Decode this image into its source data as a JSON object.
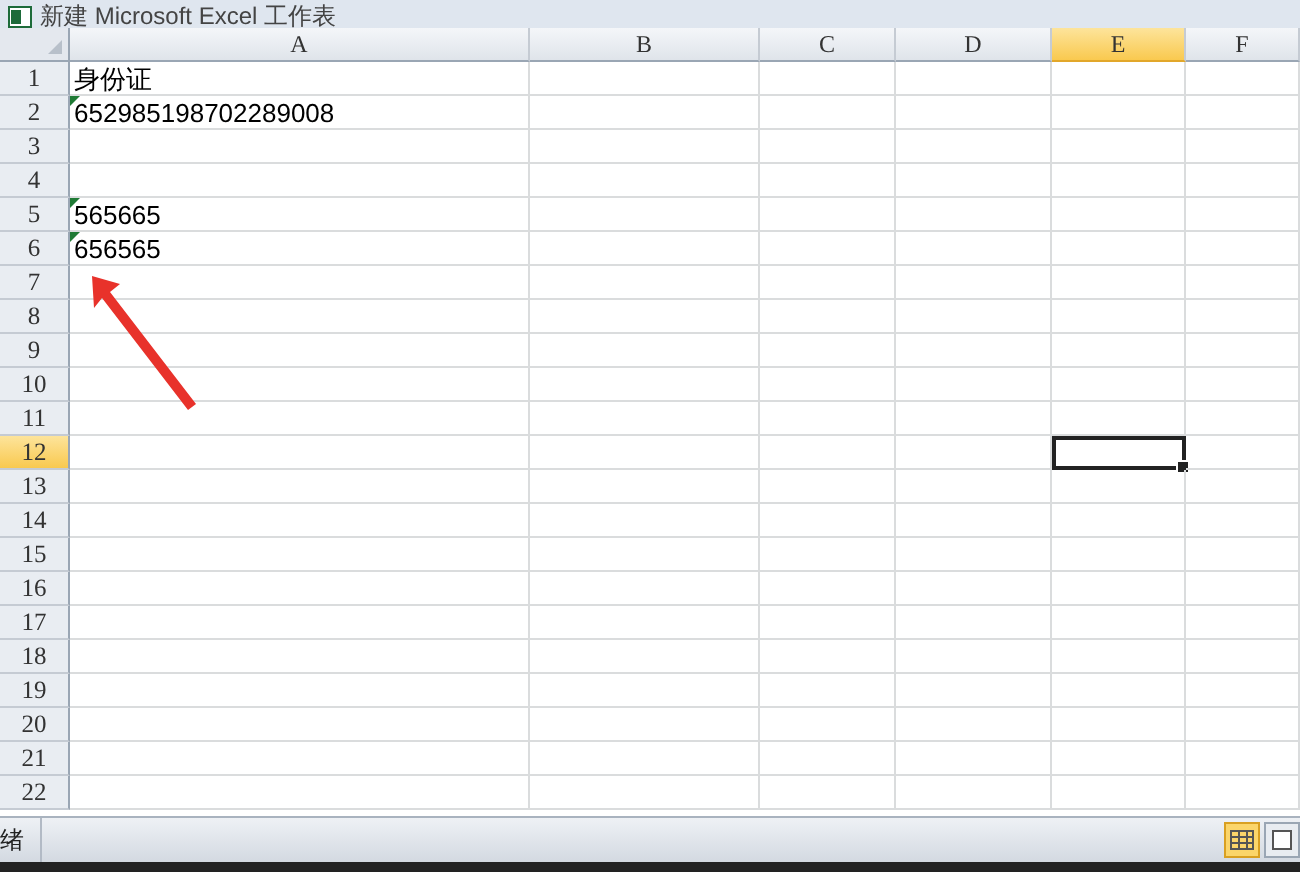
{
  "window": {
    "title": "新建 Microsoft Excel 工作表"
  },
  "columns": [
    {
      "label": "A",
      "selected": false
    },
    {
      "label": "B",
      "selected": false
    },
    {
      "label": "C",
      "selected": false
    },
    {
      "label": "D",
      "selected": false
    },
    {
      "label": "E",
      "selected": true
    },
    {
      "label": "F",
      "selected": false
    }
  ],
  "rows": [
    {
      "label": "1",
      "selected": false,
      "cell_a": {
        "text": "身份证",
        "error_flag": false
      }
    },
    {
      "label": "2",
      "selected": false,
      "cell_a": {
        "text": "652985198702289008",
        "error_flag": true
      }
    },
    {
      "label": "3",
      "selected": false
    },
    {
      "label": "4",
      "selected": false
    },
    {
      "label": "5",
      "selected": false,
      "cell_a": {
        "text": "565665",
        "error_flag": true
      }
    },
    {
      "label": "6",
      "selected": false,
      "cell_a": {
        "text": "656565",
        "error_flag": true
      }
    },
    {
      "label": "7",
      "selected": false
    },
    {
      "label": "8",
      "selected": false
    },
    {
      "label": "9",
      "selected": false
    },
    {
      "label": "10",
      "selected": false
    },
    {
      "label": "11",
      "selected": false
    },
    {
      "label": "12",
      "selected": true
    },
    {
      "label": "13",
      "selected": false
    },
    {
      "label": "14",
      "selected": false
    },
    {
      "label": "15",
      "selected": false
    },
    {
      "label": "16",
      "selected": false
    },
    {
      "label": "17",
      "selected": false
    },
    {
      "label": "18",
      "selected": false
    },
    {
      "label": "19",
      "selected": false
    },
    {
      "label": "20",
      "selected": false
    },
    {
      "label": "21",
      "selected": false
    },
    {
      "label": "22",
      "selected": false
    }
  ],
  "status_bar": {
    "text": "绪"
  }
}
